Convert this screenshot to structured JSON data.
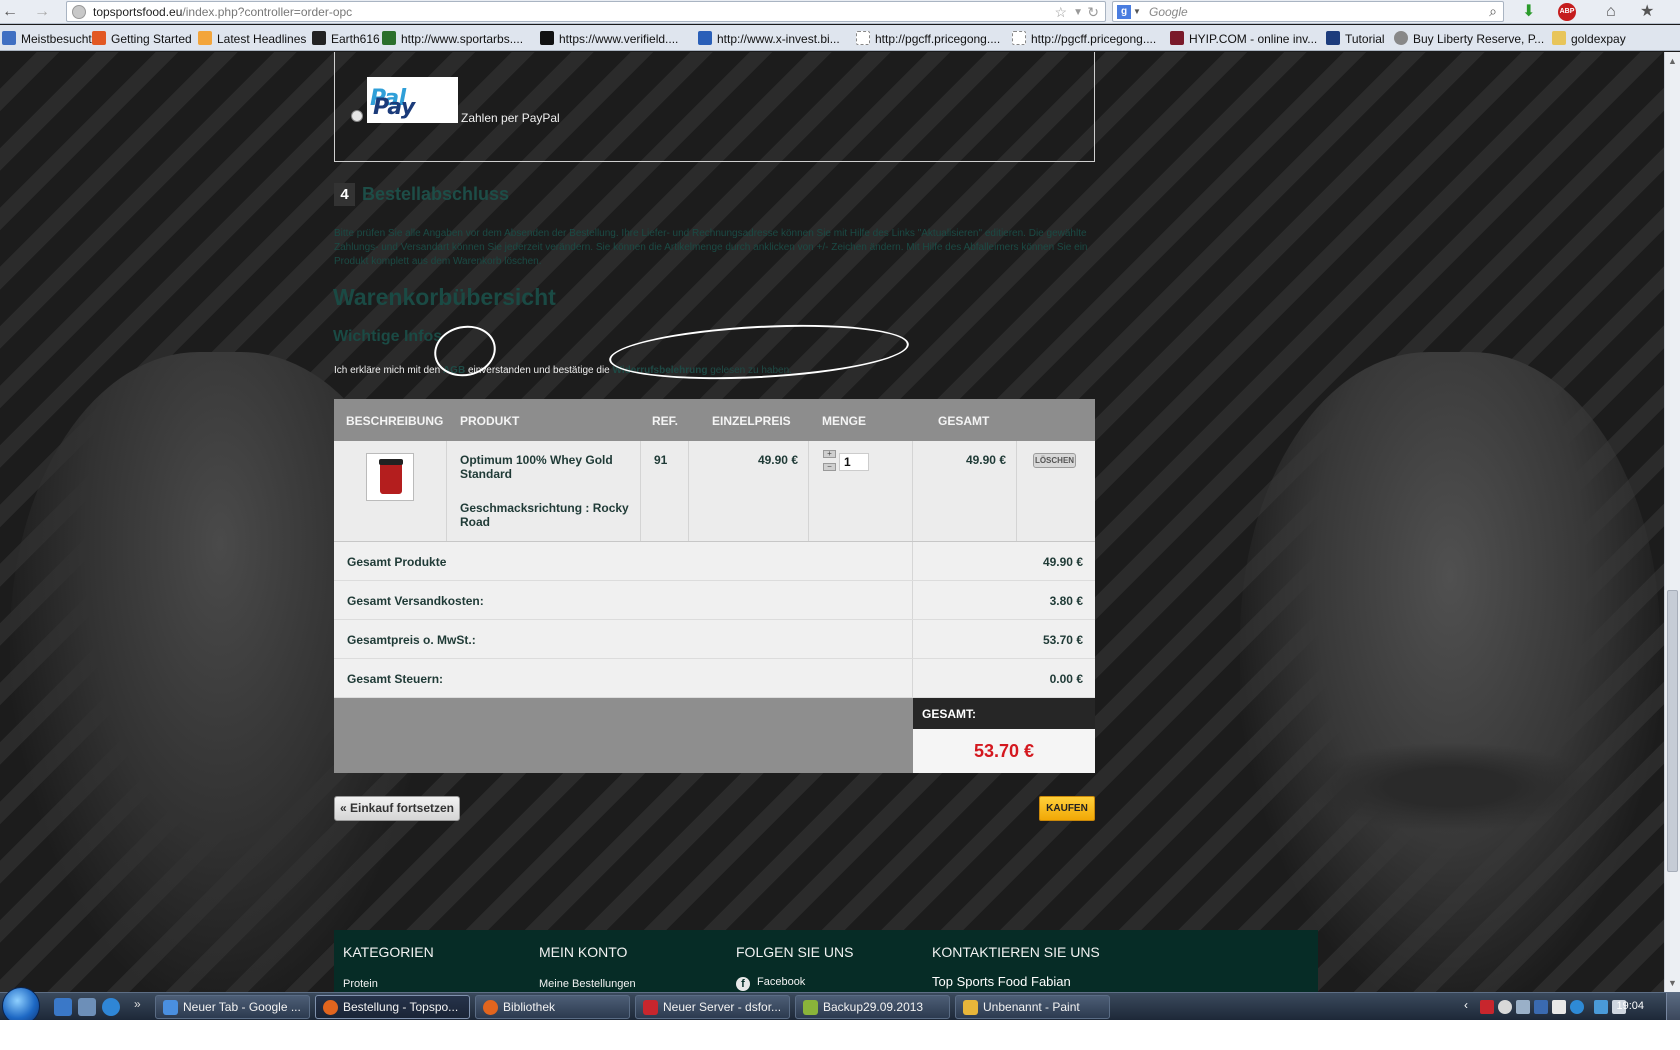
{
  "browser": {
    "url_domain": "topsportsfood.eu",
    "url_rest": "/index.php?controller=order-opc",
    "search_placeholder": "Google",
    "bookmarks": [
      {
        "label": "Meistbesucht",
        "color": "#3f6fc2"
      },
      {
        "label": "Getting Started",
        "color": "#e25822"
      },
      {
        "label": "Latest Headlines",
        "color": "#f3a53b"
      },
      {
        "label": "Earth616",
        "color": "#222222"
      },
      {
        "label": "http://www.sportarbs....",
        "color": "#2b6f2b"
      },
      {
        "label": "https://www.verifield....",
        "color": "#111111"
      },
      {
        "label": "http://www.x-invest.bi...",
        "color": "#2a5fb8"
      },
      {
        "label": "http://pgcff.pricegong....",
        "color": "#ffffff"
      },
      {
        "label": "http://pgcff.pricegong....",
        "color": "#ffffff"
      },
      {
        "label": "HYIP.COM - online inv...",
        "color": "#7a1a2a"
      },
      {
        "label": "Tutorial",
        "color": "#1d3c7c"
      },
      {
        "label": "Buy Liberty Reserve, P...",
        "color": "#888888"
      },
      {
        "label": "goldexpay",
        "color": "#e8c55a"
      }
    ]
  },
  "payment": {
    "paypal_logo_dark": "Pay",
    "paypal_logo_light": "Pal",
    "paypal_label": "Zahlen per PayPal"
  },
  "step4": {
    "number": "4",
    "title": "Bestellabschluss",
    "text": "Bitte prüfen Sie alle Angaben vor dem Absenden der Bestellung. Ihre Liefer- und Rechnungsadresse können Sie mit Hilfe des Links \"Aktualisieren\" editieren. Die gewählte Zahlungs- und Versandart können Sie jederzeit verändern. Sie können die Artikelmenge durch anklicken von +/- Zeichen ändern. Mit Hilfe des Abfalleimers können Sie ein Produkt komplett aus dem Warenkorb löschen."
  },
  "cart": {
    "title": "Warenkorbübersicht",
    "info_title": "Wichtige Infos",
    "terms_pre": "Ich erkläre mich mit den ",
    "terms_agb": "AGB",
    "terms_mid": " einverstanden und bestätige die ",
    "terms_withdrawal": "Widerrufsbelehrung",
    "terms_post": " gelesen zu haben.",
    "headers": {
      "description": "BESCHREIBUNG",
      "product": "PRODUKT",
      "ref": "REF.",
      "unit_price": "EINZELPREIS",
      "quantity": "MENGE",
      "total": "GESAMT"
    },
    "item": {
      "name": "Optimum 100% Whey Gold Standard",
      "flavor": "Geschmacksrichtung : Rocky Road",
      "ref": "91",
      "unit_price": "49.90 €",
      "quantity": "1",
      "total": "49.90 €",
      "delete_label": "LÖSCHEN"
    },
    "summary": [
      {
        "label": "Gesamt Produkte",
        "value": "49.90 €"
      },
      {
        "label": "Gesamt Versandkosten:",
        "value": "3.80 €"
      },
      {
        "label": "Gesamtpreis o. MwSt.:",
        "value": "53.70 €"
      },
      {
        "label": "Gesamt Steuern:",
        "value": "0.00 €"
      }
    ],
    "grand_total_label": "GESAMT:",
    "grand_total_value": "53.70 €",
    "continue_label": "« Einkauf fortsetzen",
    "buy_label": "KAUFEN"
  },
  "footer": {
    "col1_title": "KATEGORIEN",
    "col1_link": "Protein",
    "col2_title": "MEIN KONTO",
    "col2_link": "Meine Bestellungen",
    "col3_title": "FOLGEN SIE UNS",
    "col3_link": "Facebook",
    "col4_title": "KONTAKTIEREN SIE UNS",
    "contact_name": "Top Sports Food Fabian"
  },
  "taskbar": {
    "items": [
      {
        "label": "Neuer Tab - Google ...",
        "icon_color": "#4a8fe0"
      },
      {
        "label": "Bestellung - Topspo...",
        "icon_color": "#e2651e"
      },
      {
        "label": "Bibliothek",
        "icon_color": "#e2651e"
      },
      {
        "label": "Neuer Server - dsfor...",
        "icon_color": "#c8262d"
      },
      {
        "label": "Backup29.09.2013",
        "icon_color": "#8ab43a"
      },
      {
        "label": "Unbenannt - Paint",
        "icon_color": "#e8b63a"
      }
    ],
    "clock": "19:04"
  }
}
